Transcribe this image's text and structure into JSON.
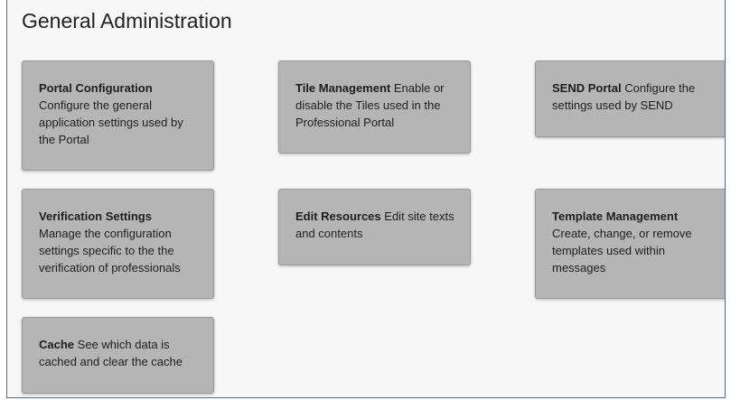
{
  "page": {
    "title": "General Administration"
  },
  "tiles": [
    {
      "title": "Portal Configuration",
      "description": "Configure the general application settings used by the Portal"
    },
    {
      "title": "Tile Management",
      "description": "Enable or disable the Tiles used in the Professional Portal"
    },
    {
      "title": "SEND Portal",
      "description": "Configure the settings used by SEND"
    },
    {
      "title": "Verification Settings",
      "description": "Manage the configuration settings specific to the the verification of professionals"
    },
    {
      "title": "Edit Resources",
      "description": "Edit site texts and contents"
    },
    {
      "title": "Template Management",
      "description": "Create, change, or remove templates used within messages"
    },
    {
      "title": "Cache",
      "description": "See which data is cached and clear the cache"
    }
  ]
}
